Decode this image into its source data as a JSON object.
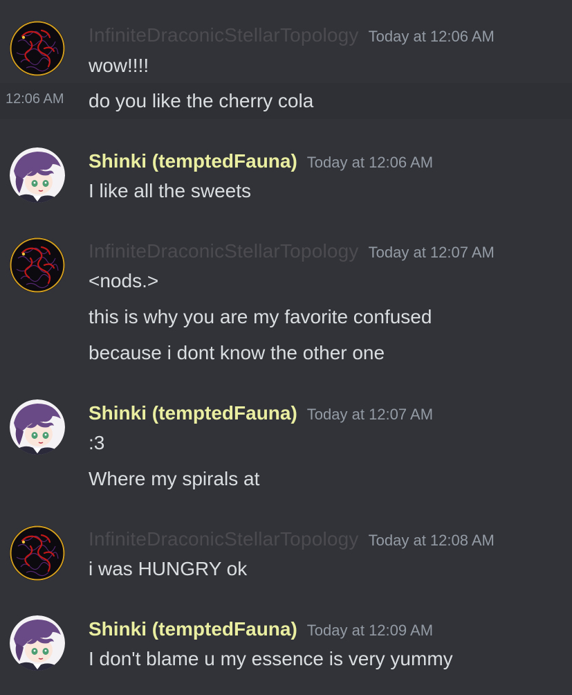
{
  "users": {
    "infinite": {
      "name": "InfiniteDraconicStellarTopology",
      "name_color": "#4b4b50",
      "avatar_icon": "red-serpent-dragon-avatar"
    },
    "shinki": {
      "name": "Shinki (temptedFauna)",
      "name_color": "#eaeea0",
      "avatar_icon": "purple-haired-anime-girl-avatar"
    }
  },
  "messages": [
    {
      "author": "InfiniteDraconicStellarTopology",
      "timestamp": "Today at 12:06 AM",
      "lines": [
        "wow!!!!",
        "do you like the cherry cola"
      ],
      "hover_timestamp": "12:06 AM"
    },
    {
      "author": "Shinki (temptedFauna)",
      "timestamp": "Today at 12:06 AM",
      "lines": [
        "I like all the sweets"
      ]
    },
    {
      "author": "InfiniteDraconicStellarTopology",
      "timestamp": "Today at 12:07 AM",
      "lines": [
        "<nods.>",
        "this is why you are my favorite confused",
        "because i dont know the other one"
      ]
    },
    {
      "author": "Shinki (temptedFauna)",
      "timestamp": "Today at 12:07 AM",
      "lines": [
        ":3",
        "Where my spirals at"
      ]
    },
    {
      "author": "InfiniteDraconicStellarTopology",
      "timestamp": "Today at 12:08 AM",
      "lines": [
        "i was HUNGRY ok"
      ]
    },
    {
      "author": "Shinki (temptedFauna)",
      "timestamp": "Today at 12:09 AM",
      "lines": [
        "I don't blame u my essence is very yummy"
      ]
    }
  ],
  "colors": {
    "background": "#313338",
    "hover_row": "#2e3035",
    "text": "#dbdee1",
    "timestamp": "#949ba4"
  }
}
